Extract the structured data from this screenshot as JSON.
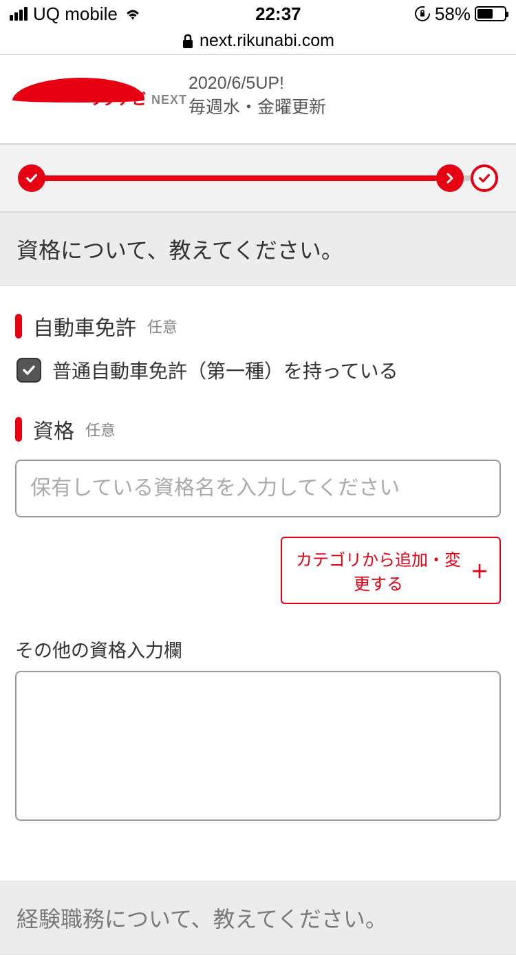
{
  "status": {
    "carrier": "UQ mobile",
    "time": "22:37",
    "battery_pct": "58%"
  },
  "url": {
    "domain": "next.rikunabi.com"
  },
  "header": {
    "logo_jp": "リクナビ",
    "logo_en": "NEXT",
    "date_line": "2020/6/5UP!",
    "tagline": "毎週水・金曜更新"
  },
  "sections": {
    "qualifications_heading": "資格について、教えてください。",
    "experience_heading": "経験職務について、教えてください。"
  },
  "fields": {
    "license": {
      "label": "自動車免許",
      "optional": "任意",
      "checkbox_label": "普通自動車免許（第一種）を持っている",
      "checked": true
    },
    "qualifications": {
      "label": "資格",
      "optional": "任意",
      "placeholder": "保有している資格名を入力してください",
      "category_button": "カテゴリから追加・変更する"
    },
    "other": {
      "label": "その他の資格入力欄"
    }
  }
}
